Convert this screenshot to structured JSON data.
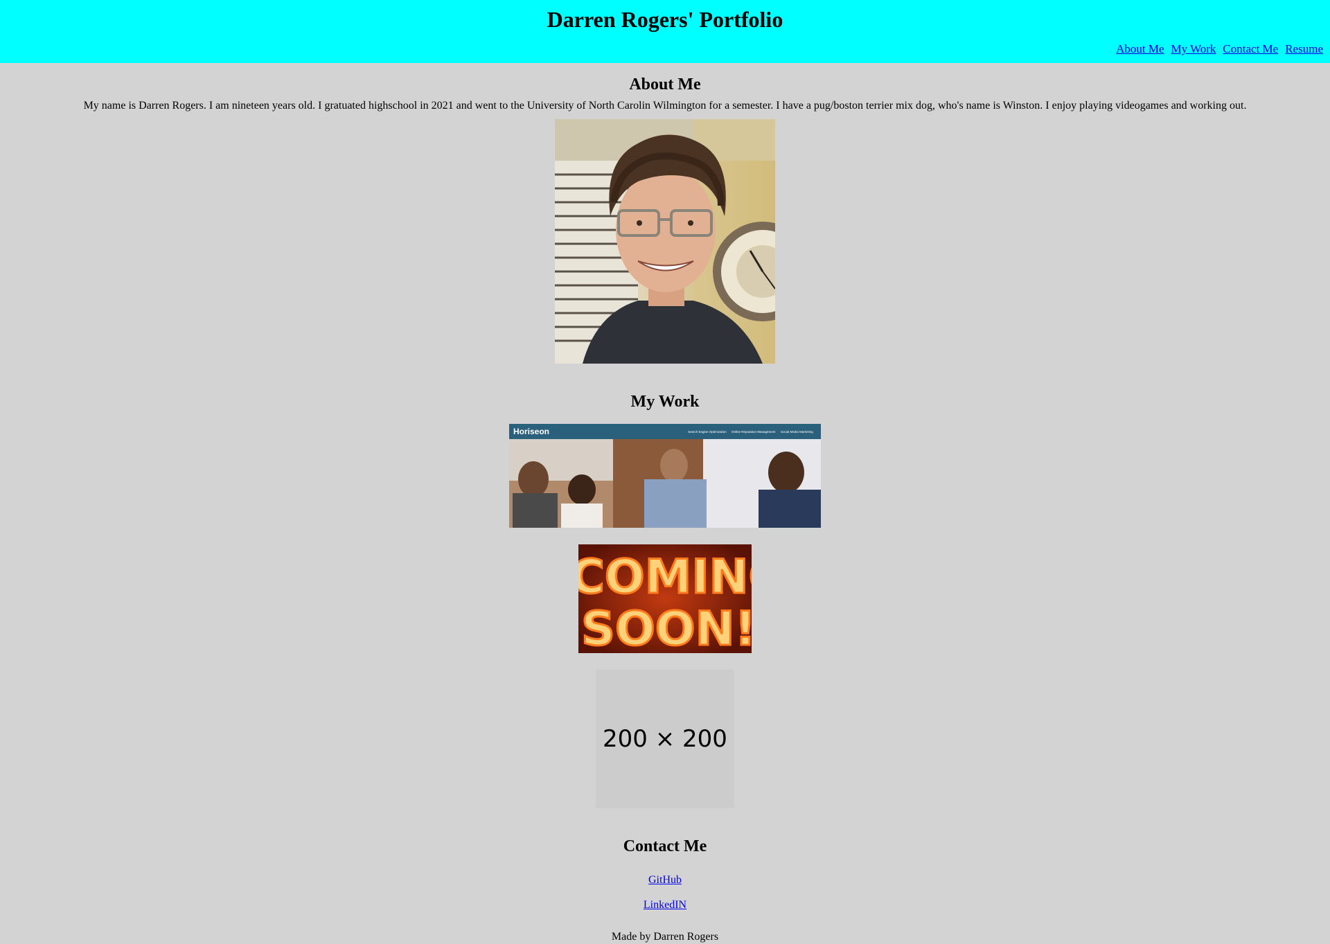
{
  "header": {
    "title": "Darren Rogers' Portfolio",
    "nav": [
      "About Me",
      "My Work",
      "Contact Me",
      "Resume"
    ],
    "background_color": "#00ffff"
  },
  "about": {
    "heading": "About Me",
    "text": "My name is Darren Rogers. I am nineteen years old. I gratuated highschool in 2021 and went to the University of North Carolin Wilmington for a semester. I have a pug/boston terrier mix dog, who's name is Winston. I enjoy playing videogames and working out.",
    "photo_icon": "portrait-photo"
  },
  "work": {
    "heading": "My Work",
    "projects": [
      {
        "image": "horiseon-screenshot",
        "brand": "Horiseon",
        "menu": [
          "Search Engine Optimization",
          "Online Reputation Management",
          "Social Media Marketing"
        ]
      },
      {
        "image": "coming-soon-neon",
        "line1": "COMINC",
        "line2": "SOON!"
      },
      {
        "image": "placeholder",
        "label": "200 × 200"
      }
    ]
  },
  "contact": {
    "heading": "Contact Me",
    "links": [
      "GitHub",
      "LinkedIN"
    ]
  },
  "footer": {
    "text": "Made by Darren Rogers"
  },
  "colors": {
    "page_background": "#d3d3d3",
    "link": "#0000ee"
  }
}
